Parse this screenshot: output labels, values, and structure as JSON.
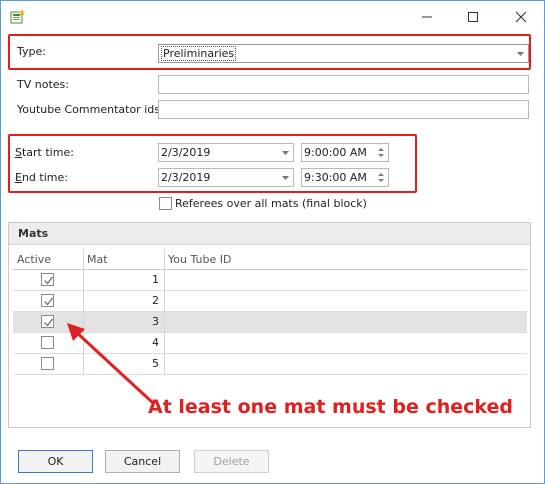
{
  "window": {
    "icon": "app-form-icon",
    "buttons": [
      "minimize-icon",
      "maximize-icon",
      "close-icon"
    ]
  },
  "form": {
    "type_label": "Type:",
    "type_value": "Preliminaries",
    "tv_notes_label": "TV notes:",
    "tv_notes_value": "",
    "youtube_label": "Youtube Commentator ids:",
    "youtube_value": "",
    "start_label_first": "S",
    "start_label_rest": "tart time:",
    "start_date": "2/3/2019",
    "start_time": "9:00:00 AM",
    "end_label_first": "E",
    "end_label_rest": "nd time:",
    "end_date": "2/3/2019",
    "end_time": "9:30:00 AM",
    "referees_label": "Referees over all mats (final block)",
    "referees_checked": false
  },
  "mats": {
    "title": "Mats",
    "columns": [
      "Active",
      "Mat",
      "You Tube ID"
    ],
    "rows": [
      {
        "active": true,
        "mat": "1",
        "youtube_id": ""
      },
      {
        "active": true,
        "mat": "2",
        "youtube_id": ""
      },
      {
        "active": true,
        "mat": "3",
        "youtube_id": "",
        "selected": true
      },
      {
        "active": false,
        "mat": "4",
        "youtube_id": ""
      },
      {
        "active": false,
        "mat": "5",
        "youtube_id": ""
      }
    ]
  },
  "annotation": {
    "text": "At least one mat must be checked",
    "color": "#e02020"
  },
  "buttons": {
    "ok": "OK",
    "cancel": "Cancel",
    "delete": "Delete"
  },
  "colors": {
    "highlight": "#e02020",
    "window_border": "#5d9cd8",
    "selected_row": "#e3e3e3"
  }
}
